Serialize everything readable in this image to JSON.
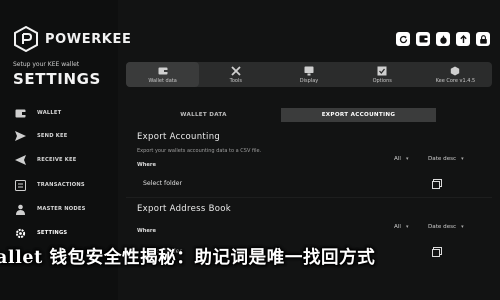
{
  "app": {
    "brand": "POWERKEE",
    "subtitle": "Setup your KEE wallet",
    "section": "SETTINGS"
  },
  "sidebar": {
    "items": [
      {
        "label": "WALLET",
        "icon": "wallet-icon"
      },
      {
        "label": "SEND KEE",
        "icon": "send-icon"
      },
      {
        "label": "RECEIVE KEE",
        "icon": "receive-icon"
      },
      {
        "label": "TRANSACTIONS",
        "icon": "transactions-icon"
      },
      {
        "label": "MASTER NODES",
        "icon": "master-nodes-icon"
      },
      {
        "label": "SETTINGS",
        "icon": "settings-icon",
        "active": true
      }
    ]
  },
  "window_controls": [
    "refresh-icon",
    "wallet-status-icon",
    "tor-icon",
    "sync-icon",
    "lock-icon"
  ],
  "tabs": [
    {
      "label": "Wallet data",
      "icon": "wallet-data-icon",
      "active": true
    },
    {
      "label": "Tools",
      "icon": "tools-icon"
    },
    {
      "label": "Display",
      "icon": "display-icon"
    },
    {
      "label": "Options",
      "icon": "options-icon"
    },
    {
      "label": "Kee Core v1.4.5",
      "icon": "kee-core-icon"
    }
  ],
  "subtabs": [
    {
      "label": "WALLET DATA"
    },
    {
      "label": "EXPORT ACCOUNTING",
      "active": true
    }
  ],
  "export_accounting": {
    "title": "Export Accounting",
    "description": "Export your wallets accounting data to a CSV file.",
    "where_label": "Where",
    "filter_all": "All",
    "filter_sort": "Date desc",
    "folder_placeholder": "Select folder"
  },
  "export_address_book": {
    "title": "Export Address Book",
    "where_label": "Where",
    "filter_all": "All",
    "filter_sort": "Date desc",
    "folder_placeholder": "Select folder"
  },
  "overlay_text": "allet 钱包安全性揭秘：助记词是唯一找回方式",
  "colors": {
    "background": "#121313",
    "sidebar": "#0e0f0f",
    "panel": "#2b2c2c",
    "active": "#3a3b3b"
  }
}
